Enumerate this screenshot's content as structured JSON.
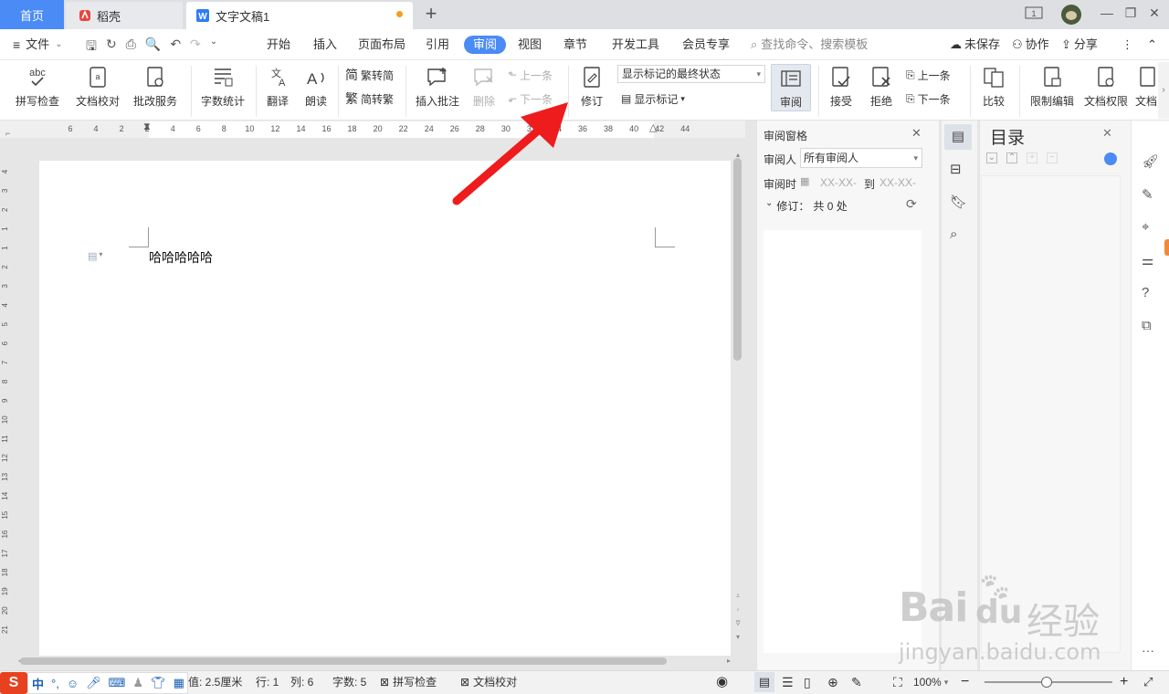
{
  "tabs": {
    "home": "首页",
    "daoke": "稻壳",
    "doc": "文字文稿1"
  },
  "menu": {
    "file": "文件",
    "items": [
      "开始",
      "插入",
      "页面布局",
      "引用",
      "审阅",
      "视图",
      "章节",
      "开发工具",
      "会员专享"
    ],
    "active": "审阅",
    "search_placeholder": "查找命令、搜索模板",
    "unsaved": "未保存",
    "collab": "协作",
    "share": "分享"
  },
  "ribbon": {
    "spell": "拼写检查",
    "proofread": "文档校对",
    "review_service": "批改服务",
    "wordcount": "字数统计",
    "translate": "翻译",
    "read": "朗读",
    "trad_simp": "繁转简",
    "simp_trad": "简转繁",
    "insert_comment": "插入批注",
    "delete": "删除",
    "prev": "上一条",
    "next": "下一条",
    "revise": "修订",
    "markup_state": "显示标记的最终状态",
    "show_markup": "显示标记",
    "review": "审阅",
    "accept": "接受",
    "reject": "拒绝",
    "prev2": "上一条",
    "next2": "下一条",
    "compare": "比较",
    "restrict": "限制编辑",
    "permission": "文档权限",
    "doc_cut": "文档"
  },
  "ruler": {
    "h_ticks": [
      "6",
      "4",
      "2",
      "2",
      "4",
      "6",
      "8",
      "10",
      "12",
      "14",
      "16",
      "18",
      "20",
      "22",
      "24",
      "26",
      "28",
      "30",
      "32",
      "34",
      "36",
      "38",
      "40",
      "42",
      "44"
    ],
    "v_ticks": [
      "4",
      "3",
      "2",
      "1",
      "1",
      "2",
      "3",
      "4",
      "5",
      "6",
      "7",
      "8",
      "9",
      "10",
      "11",
      "12",
      "13",
      "14",
      "15",
      "16",
      "17",
      "18",
      "19",
      "20",
      "21"
    ]
  },
  "document": {
    "text": "哈哈哈哈哈"
  },
  "review_pane": {
    "title": "审阅窗格",
    "reviewer_label": "审阅人",
    "reviewer_value": "所有审阅人",
    "time_label": "审阅时",
    "time_from": "XX-XX-",
    "to": "到",
    "time_to": "XX-XX-",
    "revisions": "修订：",
    "revisions_count": "共 0 处"
  },
  "toc": {
    "title": "目录"
  },
  "status": {
    "ime": "中",
    "indent": "值: 2.5厘米",
    "row": "行: 1",
    "col": "列: 6",
    "words": "字数: 5",
    "spell": "拼写检查",
    "proof": "文档校对",
    "zoom": "100%"
  },
  "watermark": {
    "brand": "Bai",
    "brand2": "du",
    "cn": "经验",
    "url": "jingyan.baidu.com"
  },
  "colors": {
    "accent": "#4a8bf5",
    "arrow": "#ee1c1c"
  }
}
